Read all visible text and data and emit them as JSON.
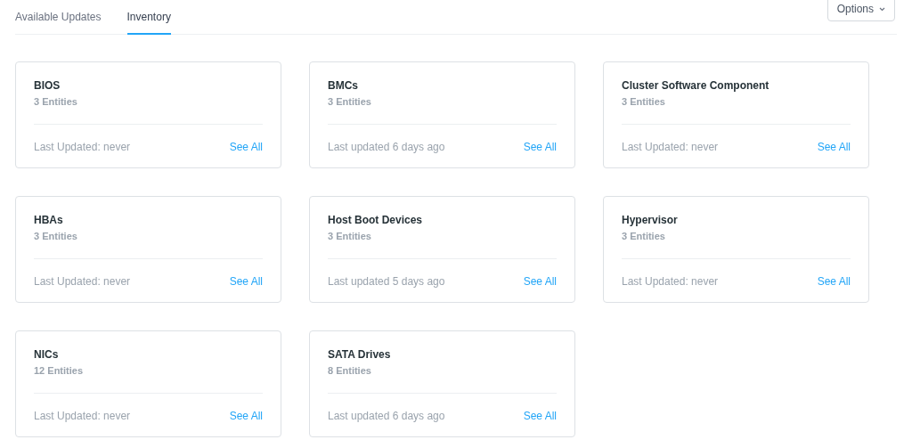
{
  "tabs": [
    {
      "label": "Available Updates",
      "selected": false
    },
    {
      "label": "Inventory",
      "selected": true
    }
  ],
  "options_button": {
    "label": "Options"
  },
  "cards": [
    {
      "title": "BIOS",
      "count": "3 Entities",
      "updated": "Last Updated: never",
      "link": "See All"
    },
    {
      "title": "BMCs",
      "count": "3 Entities",
      "updated": "Last updated 6 days ago",
      "link": "See All"
    },
    {
      "title": "Cluster Software Component",
      "count": "3 Entities",
      "updated": "Last Updated: never",
      "link": "See All"
    },
    {
      "title": "HBAs",
      "count": "3 Entities",
      "updated": "Last Updated: never",
      "link": "See All"
    },
    {
      "title": "Host Boot Devices",
      "count": "3 Entities",
      "updated": "Last updated 5 days ago",
      "link": "See All"
    },
    {
      "title": "Hypervisor",
      "count": "3 Entities",
      "updated": "Last Updated: never",
      "link": "See All"
    },
    {
      "title": "NICs",
      "count": "12 Entities",
      "updated": "Last Updated: never",
      "link": "See All"
    },
    {
      "title": "SATA Drives",
      "count": "8 Entities",
      "updated": "Last updated 6 days ago",
      "link": "See All"
    }
  ]
}
